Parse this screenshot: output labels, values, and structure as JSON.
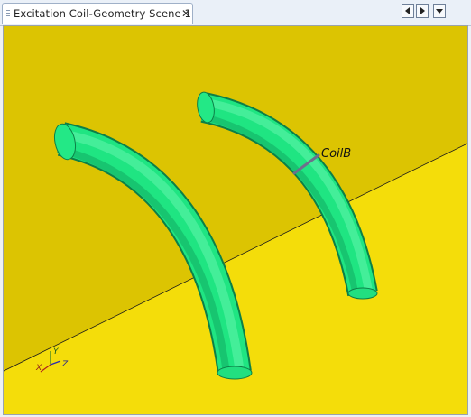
{
  "window": {
    "tab_title": "Excitation Coil-Geometry Scene 1",
    "close_glyph": "✕"
  },
  "toolbar": {
    "buttons": [
      {
        "icon": "triangle-left-icon"
      },
      {
        "icon": "triangle-right-icon"
      },
      {
        "icon": "triangle-down-icon"
      }
    ]
  },
  "scene": {
    "label": "CoilB",
    "axes": {
      "x": "X",
      "y": "Y",
      "z": "Z"
    },
    "colors": {
      "wall": "#dcc402",
      "floor": "#f5de0c",
      "coil": "#1fe582",
      "coil_highlight": "#5ff5a9",
      "coil_shadow": "#0f8a4e"
    }
  }
}
